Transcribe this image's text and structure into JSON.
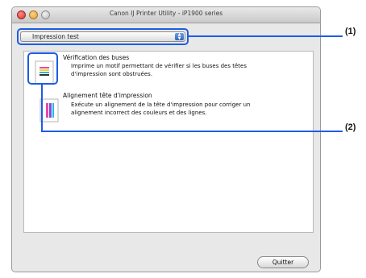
{
  "window": {
    "title": "Canon IJ Printer Utility - iP1900 series"
  },
  "popup": {
    "selected": "Impression test"
  },
  "items": [
    {
      "title": "Vérification des buses",
      "description": "Imprime un motif permettant de vérifier si les buses des têtes d'impression sont obstruées.",
      "icon": "nozzle-check-icon"
    },
    {
      "title": "Alignement tête d'impression",
      "description": "Exécute un alignement de la tête d'impression pour corriger un alignement incorrect des couleurs et des lignes.",
      "icon": "print-head-alignment-icon"
    }
  ],
  "buttons": {
    "quit": "Quitter"
  },
  "callouts": {
    "one": "(1)",
    "two": "(2)"
  },
  "colors": {
    "highlight": "#1e5ce6"
  }
}
